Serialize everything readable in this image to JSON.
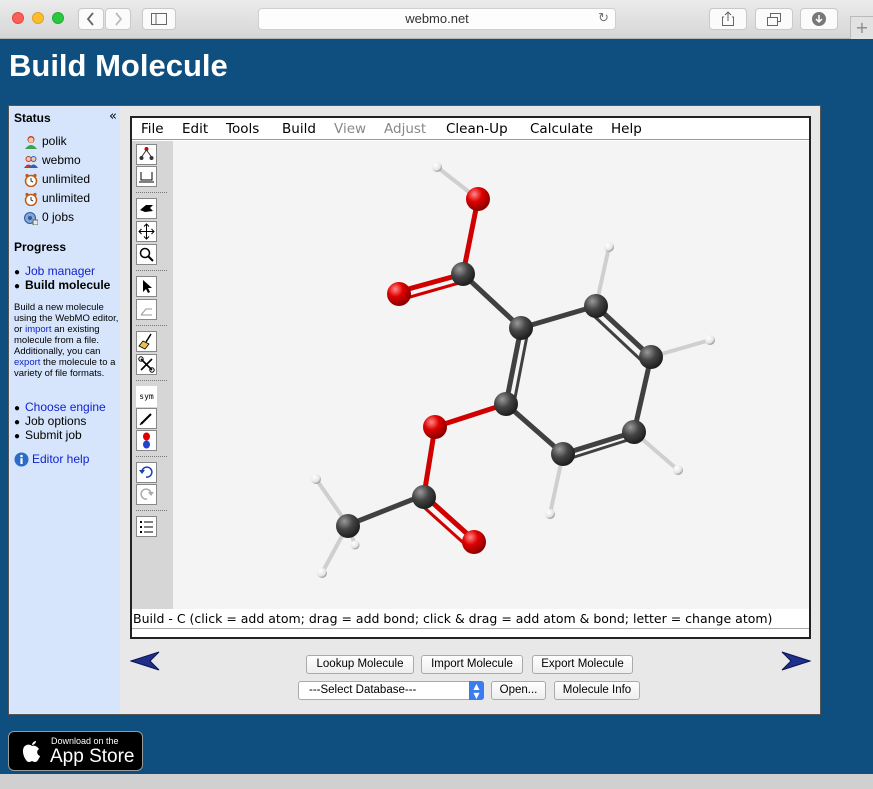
{
  "browser": {
    "url": "webmo.net"
  },
  "page": {
    "title": "Build Molecule"
  },
  "sidebar": {
    "status_heading": "Status",
    "status_items": [
      {
        "icon": "user-icon",
        "label": "polik"
      },
      {
        "icon": "group-icon",
        "label": "webmo"
      },
      {
        "icon": "clock-icon",
        "label": "unlimited"
      },
      {
        "icon": "clock-icon",
        "label": "unlimited"
      },
      {
        "icon": "jobs-icon",
        "label": "0 jobs"
      }
    ],
    "progress_heading": "Progress",
    "progress_top": [
      {
        "label": "Job manager",
        "link": true
      },
      {
        "label": "Build molecule",
        "link": false,
        "bold": true
      }
    ],
    "help_text": {
      "a": "Build a new molecule using the WebMO editor, or ",
      "import": "import",
      "b": " an existing molecule from a file. Additionally, you can ",
      "export": "export",
      "c": " the molecule to a variety of file formats."
    },
    "progress_bottom": [
      {
        "label": "Choose engine",
        "link": true
      },
      {
        "label": "Job options",
        "link": false
      },
      {
        "label": "Submit job",
        "link": false
      }
    ],
    "editor_help": "Editor help"
  },
  "editor": {
    "menu": [
      {
        "label": "File",
        "enabled": true
      },
      {
        "label": "Edit",
        "enabled": true
      },
      {
        "label": "Tools",
        "enabled": true
      },
      {
        "label": "Build",
        "enabled": true
      },
      {
        "label": "View",
        "enabled": false
      },
      {
        "label": "Adjust",
        "enabled": false
      },
      {
        "label": "Clean-Up",
        "enabled": true
      },
      {
        "label": "Calculate",
        "enabled": true
      },
      {
        "label": "Help",
        "enabled": true
      }
    ],
    "sym_label": "sym",
    "status_line": "Build - C (click = add atom; drag = add bond; click & drag = add atom & bond; letter = change atom)"
  },
  "actions": {
    "lookup": "Lookup Molecule",
    "import": "Import Molecule",
    "export": "Export Molecule",
    "database_selected": "---Select Database---",
    "open": "Open...",
    "molecule_info": "Molecule Info"
  },
  "appstore": {
    "small": "Download on the",
    "big": "App Store"
  },
  "colors": {
    "carbon": "#3d3d3d",
    "oxygen": "#e00000",
    "hydrogen": "#ffffff",
    "bond": "#404040",
    "page_bg": "#0e4f80"
  }
}
